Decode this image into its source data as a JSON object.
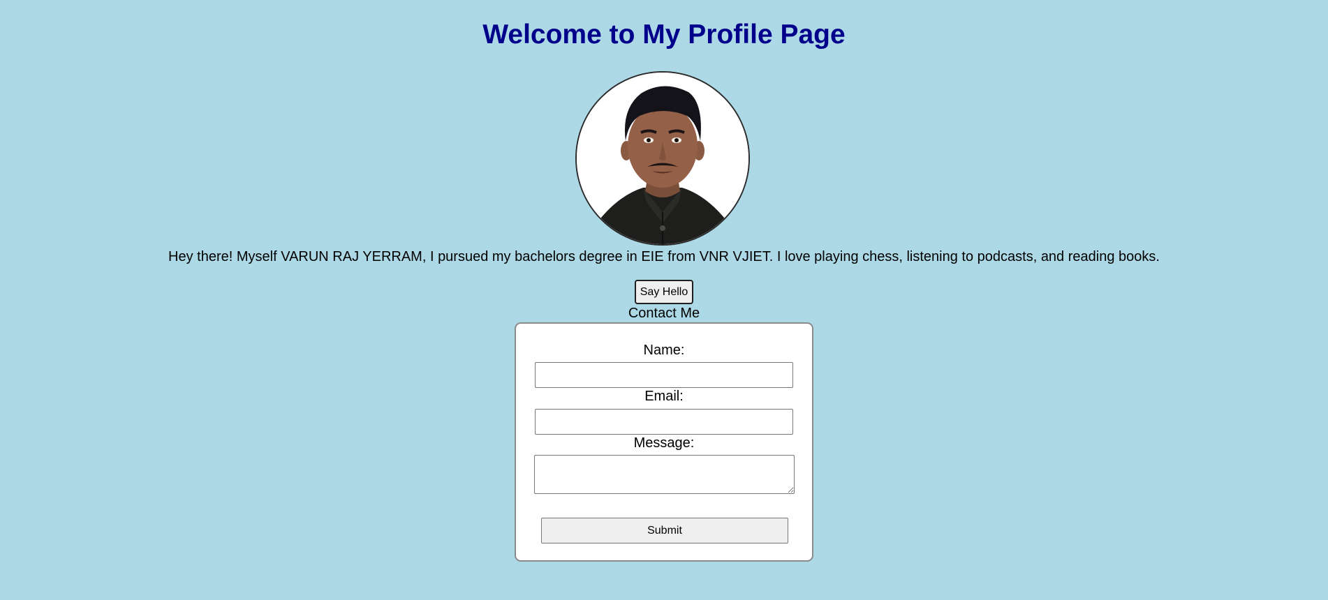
{
  "page": {
    "title": "Welcome to My Profile Page",
    "bio": "Hey there! Myself VARUN RAJ YERRAM, I pursued my bachelors degree in EIE from VNR VJIET. I love playing chess, listening to podcasts, and reading books.",
    "avatar_icon": "profile-photo",
    "hello_button_label": "Say Hello"
  },
  "contact": {
    "heading": "Contact Me",
    "name_label": "Name:",
    "name_value": "",
    "email_label": "Email:",
    "email_value": "",
    "message_label": "Message:",
    "message_value": "",
    "submit_label": "Submit"
  },
  "colors": {
    "background": "#add8e6",
    "title": "#00008b",
    "card": "#ffffff"
  }
}
